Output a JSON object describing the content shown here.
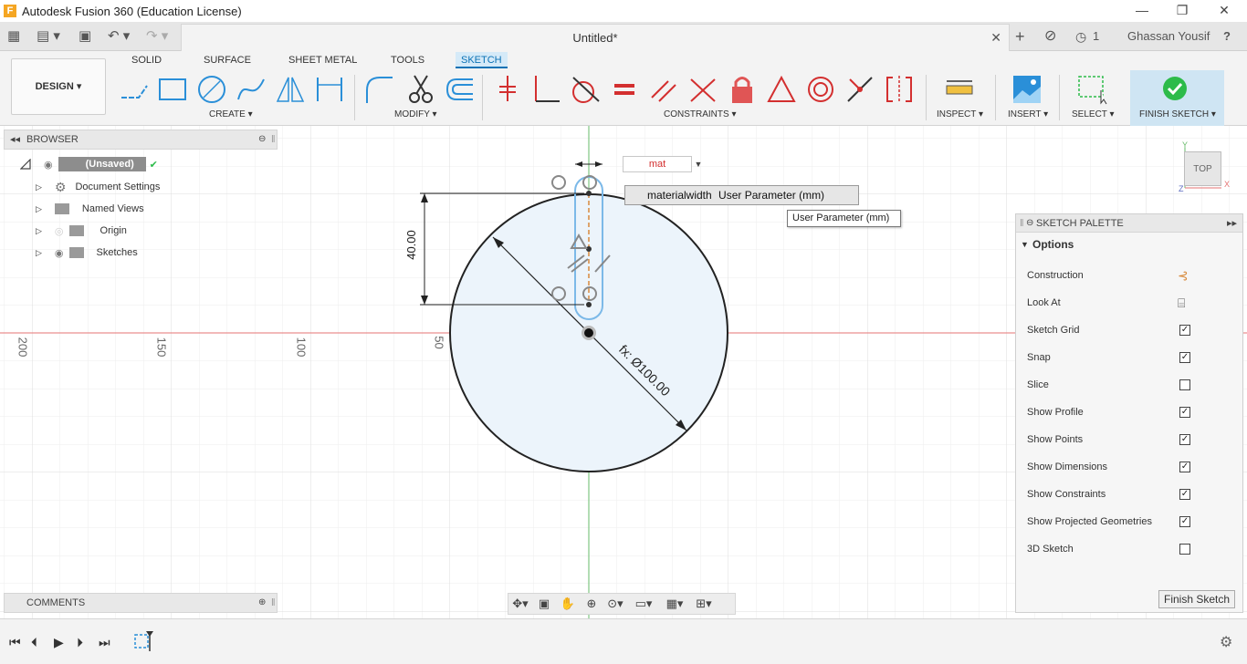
{
  "window": {
    "title": "Autodesk Fusion 360 (Education License)",
    "minimize": "—",
    "restore": "❐",
    "close": "✕"
  },
  "tabbar": {
    "doc_title": "Untitled*",
    "doc_close": "✕",
    "add_tab": "+",
    "job_count": "1",
    "user_name": "Ghassan Yousif",
    "help": "?"
  },
  "ribbon": {
    "workspace": "DESIGN ▾",
    "tabs": [
      "SOLID",
      "SURFACE",
      "SHEET METAL",
      "TOOLS",
      "SKETCH"
    ],
    "active_tab": "SKETCH",
    "groups": {
      "create": "CREATE ▾",
      "modify": "MODIFY ▾",
      "constraints": "CONSTRAINTS ▾",
      "inspect": "INSPECT ▾",
      "insert": "INSERT ▾",
      "select": "SELECT ▾",
      "finish": "FINISH SKETCH ▾"
    }
  },
  "browser": {
    "header": "BROWSER",
    "root": "(Unsaved)",
    "items": [
      "Document Settings",
      "Named Views",
      "Origin",
      "Sketches"
    ]
  },
  "comments": {
    "header": "COMMENTS"
  },
  "canvas": {
    "ruler_labels": [
      "200",
      "150",
      "100",
      "50"
    ],
    "dim_vertical": "40.00",
    "dim_diameter": "fx: Ø100.00",
    "param_input_value": "mat",
    "autocomplete_name": "materialwidth",
    "autocomplete_desc": "User Parameter (mm)",
    "tooltip": "User Parameter (mm)",
    "viewcube_label": "TOP",
    "axis_y": "Y",
    "axis_x": "X",
    "axis_z": "Z"
  },
  "palette": {
    "title": "SKETCH PALETTE",
    "section": "Options",
    "rows": [
      {
        "label": "Construction",
        "type": "icon"
      },
      {
        "label": "Look At",
        "type": "icon"
      },
      {
        "label": "Sketch Grid",
        "type": "check",
        "checked": true
      },
      {
        "label": "Snap",
        "type": "check",
        "checked": true
      },
      {
        "label": "Slice",
        "type": "check",
        "checked": false
      },
      {
        "label": "Show Profile",
        "type": "check",
        "checked": true
      },
      {
        "label": "Show Points",
        "type": "check",
        "checked": true
      },
      {
        "label": "Show Dimensions",
        "type": "check",
        "checked": true
      },
      {
        "label": "Show Constraints",
        "type": "check",
        "checked": true
      },
      {
        "label": "Show Projected Geometries",
        "type": "check",
        "checked": true
      },
      {
        "label": "3D Sketch",
        "type": "check",
        "checked": false
      }
    ],
    "finish_button": "Finish Sketch"
  },
  "colors": {
    "accent": "#0b72b5",
    "sketch_blue": "#2a8fd8",
    "profile_fill": "#ecf4fb",
    "x_axis": "#e57373",
    "y_axis": "#66bb6a",
    "constraint_red": "#d32f2f",
    "finish_green": "#2dbb4a"
  }
}
